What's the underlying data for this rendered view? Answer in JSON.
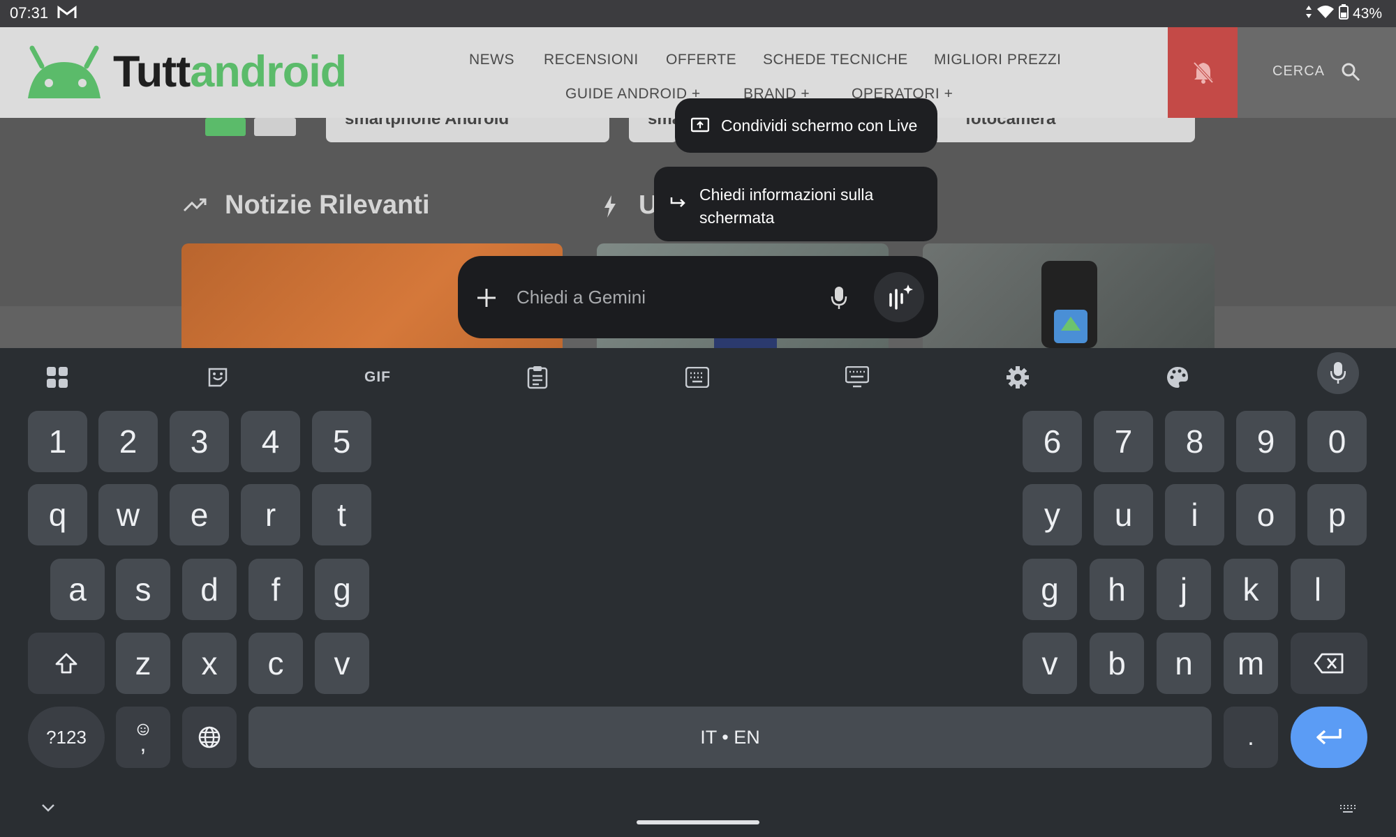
{
  "status_bar": {
    "time": "07:31",
    "battery": "43%"
  },
  "site": {
    "logo_part1": "Tutt",
    "logo_part2": "android",
    "nav_row1": [
      "NEWS",
      "RECENSIONI",
      "OFFERTE",
      "SCHEDE TECNICHE",
      "MIGLIORI PREZZI"
    ],
    "nav_row2": [
      "GUIDE ANDROID",
      "BRAND",
      "OPERATORI"
    ],
    "search_label": "CERCA",
    "cards": [
      "smartphone Android",
      "sma",
      "fotocamera"
    ],
    "section1": "Notizie Rilevanti",
    "section2": "U"
  },
  "gemini": {
    "share_live": "Condividi schermo con Live",
    "ask_screen_line1": "Chiedi informazioni sulla",
    "ask_screen_line2": "schermata",
    "input_placeholder": "Chiedi a Gemini"
  },
  "keyboard": {
    "toolbar_gif": "GIF",
    "row1_left": [
      "1",
      "2",
      "3",
      "4",
      "5"
    ],
    "row1_right": [
      "6",
      "7",
      "8",
      "9",
      "0"
    ],
    "row2_left": [
      "q",
      "w",
      "e",
      "r",
      "t"
    ],
    "row2_right": [
      "y",
      "u",
      "i",
      "o",
      "p"
    ],
    "row3_left": [
      "a",
      "s",
      "d",
      "f",
      "g"
    ],
    "row3_right": [
      "g",
      "h",
      "j",
      "k",
      "l"
    ],
    "row4_left": [
      "z",
      "x",
      "c",
      "v"
    ],
    "row4_right": [
      "v",
      "b",
      "n",
      "m"
    ],
    "symbols_key": "?123",
    "comma_key": ",",
    "space_label": "IT • EN",
    "period_key": "."
  },
  "colors": {
    "accent": "#5b9cf5",
    "brand_green": "#5bbb6a",
    "bell_red": "#c44a47"
  }
}
